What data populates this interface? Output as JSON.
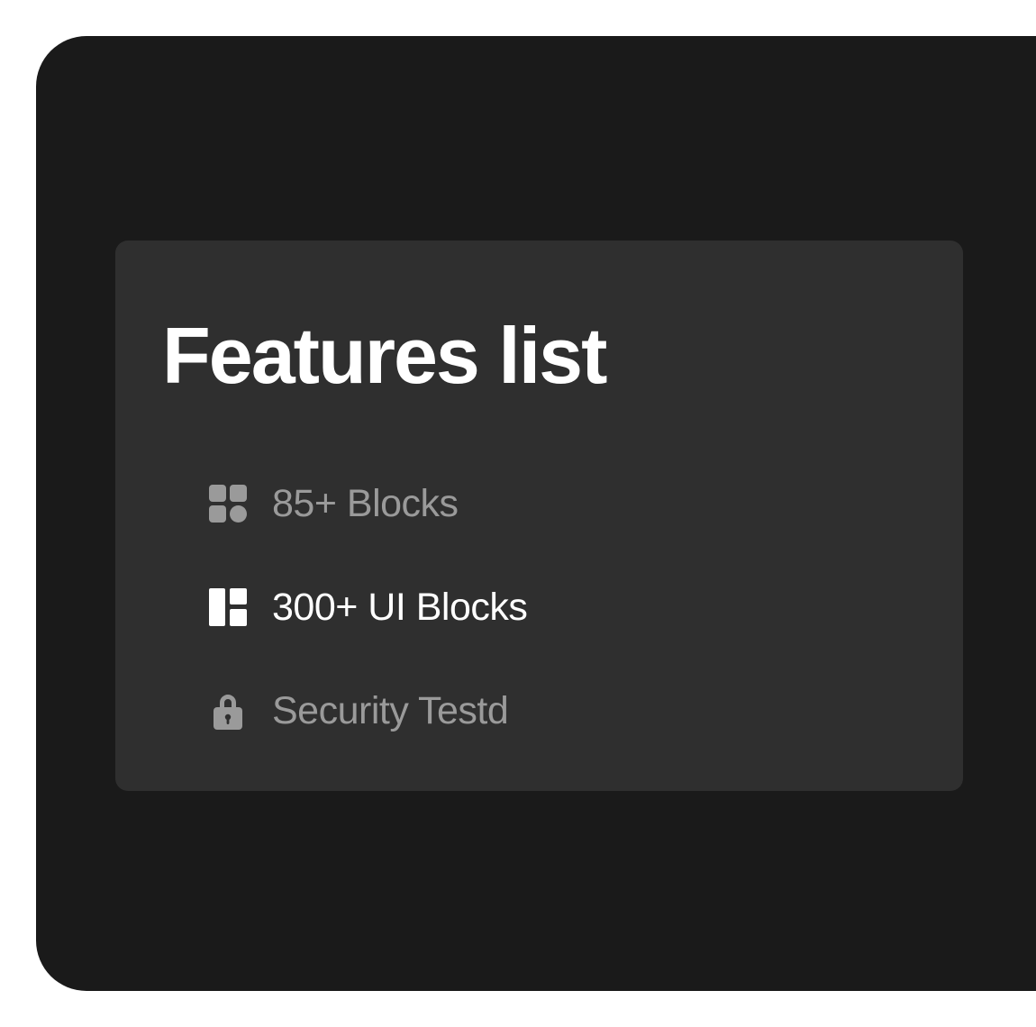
{
  "card": {
    "title": "Features list"
  },
  "features": [
    {
      "label": "85+ Blocks",
      "icon": "grid-blocks-icon",
      "state": "muted"
    },
    {
      "label": "300+ UI Blocks",
      "icon": "layout-icon",
      "state": "active"
    },
    {
      "label": "Security Testd",
      "icon": "lock-icon",
      "state": "muted"
    }
  ],
  "colors": {
    "page_background": "#ffffff",
    "frame_background": "#1a1a1a",
    "card_background": "#2f2f2f",
    "title_text": "#ffffff",
    "active_text": "#ffffff",
    "muted_text": "#9a9a9a"
  }
}
